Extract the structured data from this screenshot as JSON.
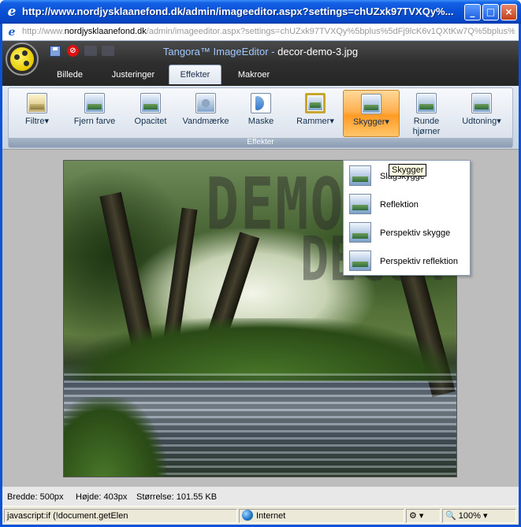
{
  "window": {
    "title": "http://www.nordjysklaanefond.dk/admin/imageeditor.aspx?settings=chUZxk97TVXQy%...",
    "address_prefix": "http://www.",
    "address_domain": "nordjysklaanefond.dk",
    "address_rest": "/admin/imageeditor.aspx?settings=chUZxk97TVXQy%5bplus%5dFj9lcK6v1QXtKw7Q%5bplus%5"
  },
  "editor": {
    "app_name": "Tangora™ ImageEditor",
    "separator": " - ",
    "file_name": "decor-demo-3.jpg",
    "tabs": [
      {
        "label": "Billede"
      },
      {
        "label": "Justeringer"
      },
      {
        "label": "Effekter",
        "active": true
      },
      {
        "label": "Makroer"
      }
    ]
  },
  "ribbon": {
    "group_label": "Effekter",
    "buttons": [
      {
        "label": "Filtre",
        "arrow": "▾",
        "icon": "filter-icon"
      },
      {
        "label": "Fjern farve",
        "arrow": "",
        "icon": "remove-color-icon"
      },
      {
        "label": "Opacitet",
        "arrow": "",
        "icon": "opacity-icon"
      },
      {
        "label": "Vandmærke",
        "arrow": "",
        "icon": "watermark-icon"
      },
      {
        "label": "Maske",
        "arrow": "",
        "icon": "mask-icon"
      },
      {
        "label": "Rammer",
        "arrow": "▾",
        "icon": "frames-icon"
      },
      {
        "label": "Skygger",
        "arrow": "▾",
        "icon": "shadow-icon",
        "active": true
      },
      {
        "label": "Runde hjørner",
        "arrow": "",
        "icon": "rounded-corners-icon"
      },
      {
        "label": "Udtoning",
        "arrow": "▾",
        "icon": "fade-icon"
      }
    ]
  },
  "image": {
    "watermark_line1": "DEMO D",
    "watermark_line2": "DECOR"
  },
  "dropdown": {
    "items": [
      {
        "label": "Slagskygge"
      },
      {
        "label": "Reflektion"
      },
      {
        "label": "Perspektiv skygge"
      },
      {
        "label": "Perspektiv reflektion"
      }
    ]
  },
  "tooltip": "Skygger",
  "info": {
    "width": "Bredde: 500px",
    "height": "Højde: 403px",
    "size": "Størrelse: 101.55 KB"
  },
  "status": {
    "text": "javascript:if (!document.getElen",
    "zone": "Internet",
    "zoom": "100%"
  },
  "colors": {
    "accent_active": "#ffb050",
    "titlebar": "#0a52d8",
    "editor_header": "#2e2e2e"
  }
}
